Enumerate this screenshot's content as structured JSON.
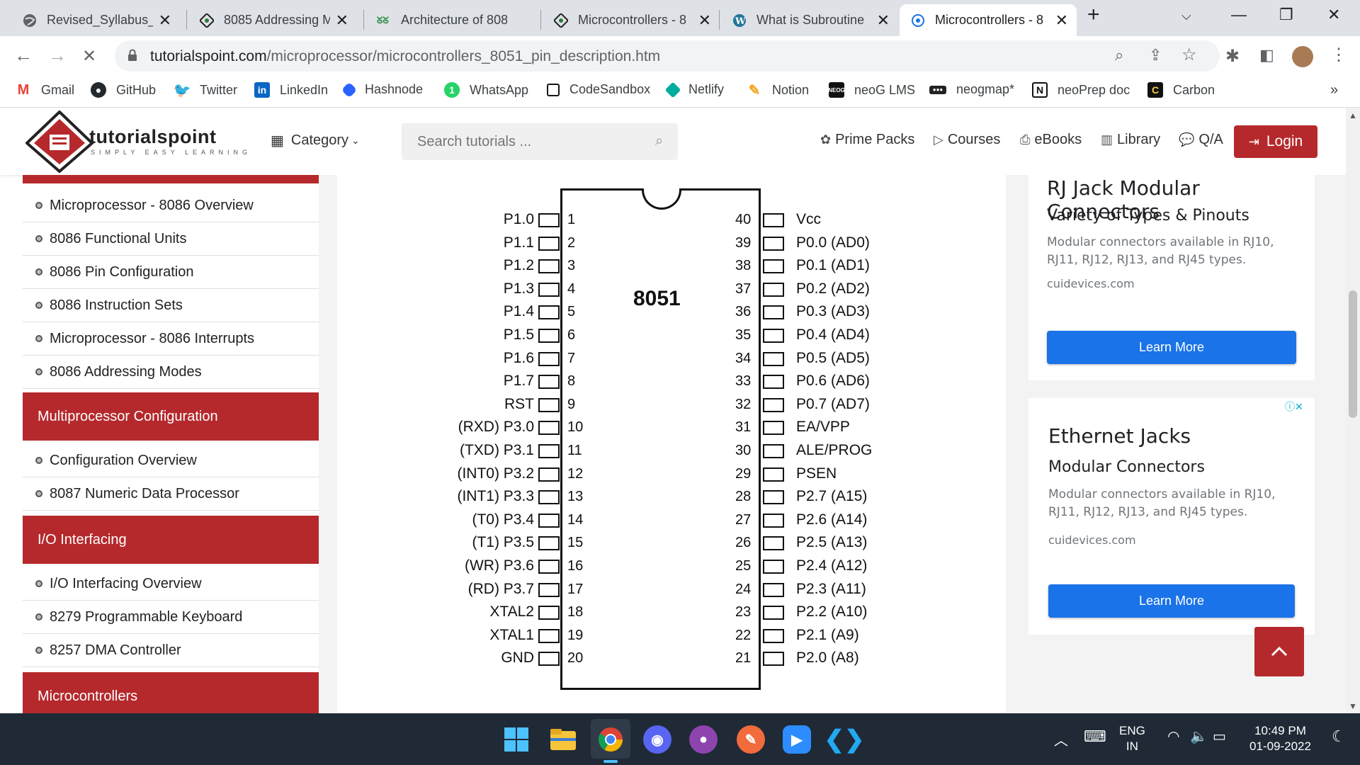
{
  "browser": {
    "tabs": [
      {
        "title": "Revised_Syllabus_fc",
        "icon": "globe-icon"
      },
      {
        "title": "8085 Addressing M",
        "icon": "geeks-icon"
      },
      {
        "title": "Architecture of 808",
        "icon": "gfg-icon"
      },
      {
        "title": "Microcontrollers - 8",
        "icon": "geeks-icon"
      },
      {
        "title": "What is Subroutine",
        "icon": "wordpress-icon"
      },
      {
        "title": "Microcontrollers - 8",
        "icon": "tutorialspoint-icon"
      }
    ],
    "url_host": "tutorialspoint.com",
    "url_path": "/microprocessor/microcontrollers_8051_pin_description.htm",
    "bookmarks": [
      {
        "label": "Gmail",
        "color": "#ea4335"
      },
      {
        "label": "GitHub",
        "color": "#24292e"
      },
      {
        "label": "Twitter",
        "color": "#1da1f2"
      },
      {
        "label": "LinkedIn",
        "color": "#0a66c2"
      },
      {
        "label": "Hashnode",
        "color": "#2962ff"
      },
      {
        "label": "WhatsApp",
        "color": "#25d366"
      },
      {
        "label": "CodeSandbox",
        "color": "#151515"
      },
      {
        "label": "Netlify",
        "color": "#00ad9f"
      },
      {
        "label": "Notion",
        "color": "#f5a623"
      },
      {
        "label": "neoG LMS",
        "color": "#111111"
      },
      {
        "label": "neogmap*",
        "color": "#222222"
      },
      {
        "label": "neoPrep doc",
        "color": "#111111"
      },
      {
        "label": "Carbon",
        "color": "#111111"
      }
    ],
    "more_bookmarks": "»"
  },
  "site": {
    "logo_text": "tutorialspoint",
    "logo_sub": "SIMPLY EASY LEARNING",
    "category": "Category",
    "search_placeholder": "Search tutorials ...",
    "nav": [
      "Prime Packs",
      "Courses",
      "eBooks",
      "Library",
      "Q/A"
    ],
    "login": "Login",
    "brand_color": "#b5292c"
  },
  "sidebar": {
    "items_a": [
      "Microprocessor - 8086 Overview",
      "8086 Functional Units",
      "8086 Pin Configuration",
      "8086 Instruction Sets",
      "Microprocessor - 8086 Interrupts",
      "8086 Addressing Modes"
    ],
    "head_b": "Multiprocessor Configuration",
    "items_b": [
      "Configuration Overview",
      "8087 Numeric Data Processor"
    ],
    "head_c": "I/O Interfacing",
    "items_c": [
      "I/O Interfacing Overview",
      "8279 Programmable Keyboard",
      "8257 DMA Controller"
    ],
    "head_d": "Microcontrollers"
  },
  "diagram": {
    "chip_name": "8051",
    "left_pins": [
      {
        "num": "1",
        "name": "P1.0"
      },
      {
        "num": "2",
        "name": "P1.1"
      },
      {
        "num": "3",
        "name": "P1.2"
      },
      {
        "num": "4",
        "name": "P1.3"
      },
      {
        "num": "5",
        "name": "P1.4"
      },
      {
        "num": "6",
        "name": "P1.5"
      },
      {
        "num": "7",
        "name": "P1.6"
      },
      {
        "num": "8",
        "name": "P1.7"
      },
      {
        "num": "9",
        "name": "RST"
      },
      {
        "num": "10",
        "name": "(RXD) P3.0"
      },
      {
        "num": "11",
        "name": "(TXD) P3.1"
      },
      {
        "num": "12",
        "name": "(INT0) P3.2"
      },
      {
        "num": "13",
        "name": "(INT1) P3.3"
      },
      {
        "num": "14",
        "name": "(T0) P3.4"
      },
      {
        "num": "15",
        "name": "(T1) P3.5"
      },
      {
        "num": "16",
        "name": "(WR) P3.6"
      },
      {
        "num": "17",
        "name": "(RD) P3.7"
      },
      {
        "num": "18",
        "name": "XTAL2"
      },
      {
        "num": "19",
        "name": "XTAL1"
      },
      {
        "num": "20",
        "name": "GND"
      }
    ],
    "right_pins": [
      {
        "num": "40",
        "name": "Vcc"
      },
      {
        "num": "39",
        "name": "P0.0 (AD0)"
      },
      {
        "num": "38",
        "name": "P0.1 (AD1)"
      },
      {
        "num": "37",
        "name": "P0.2 (AD2)"
      },
      {
        "num": "36",
        "name": "P0.3 (AD3)"
      },
      {
        "num": "35",
        "name": "P0.4 (AD4)"
      },
      {
        "num": "34",
        "name": "P0.5 (AD5)"
      },
      {
        "num": "33",
        "name": "P0.6 (AD6)"
      },
      {
        "num": "32",
        "name": "P0.7 (AD7)"
      },
      {
        "num": "31",
        "name": "EA/VPP"
      },
      {
        "num": "30",
        "name": "ALE/PROG"
      },
      {
        "num": "29",
        "name": "PSEN"
      },
      {
        "num": "28",
        "name": "P2.7 (A15)"
      },
      {
        "num": "27",
        "name": "P2.6 (A14)"
      },
      {
        "num": "26",
        "name": "P2.5 (A13)"
      },
      {
        "num": "25",
        "name": "P2.4 (A12)"
      },
      {
        "num": "24",
        "name": "P2.3 (A11)"
      },
      {
        "num": "23",
        "name": "P2.2 (A10)"
      },
      {
        "num": "22",
        "name": "P2.1 (A9)"
      },
      {
        "num": "21",
        "name": "P2.0 (A8)"
      }
    ]
  },
  "ads": [
    {
      "title": "RJ Jack Modular Connectors",
      "subtitle": "Variety of Types & Pinouts",
      "desc": "Modular connectors available in RJ10, RJ11, RJ12, RJ13, and RJ45 types.",
      "domain": "cuidevices.com",
      "button": "Learn More"
    },
    {
      "title": "Ethernet Jacks",
      "subtitle": "Modular Connectors",
      "desc": "Modular connectors available in RJ10, RJ11, RJ12, RJ13, and RJ45 types.",
      "domain": "cuidevices.com",
      "button": "Learn More"
    }
  ],
  "taskbar": {
    "lang": "ENG",
    "region": "IN",
    "time": "10:49 PM",
    "date": "01-09-2022"
  }
}
